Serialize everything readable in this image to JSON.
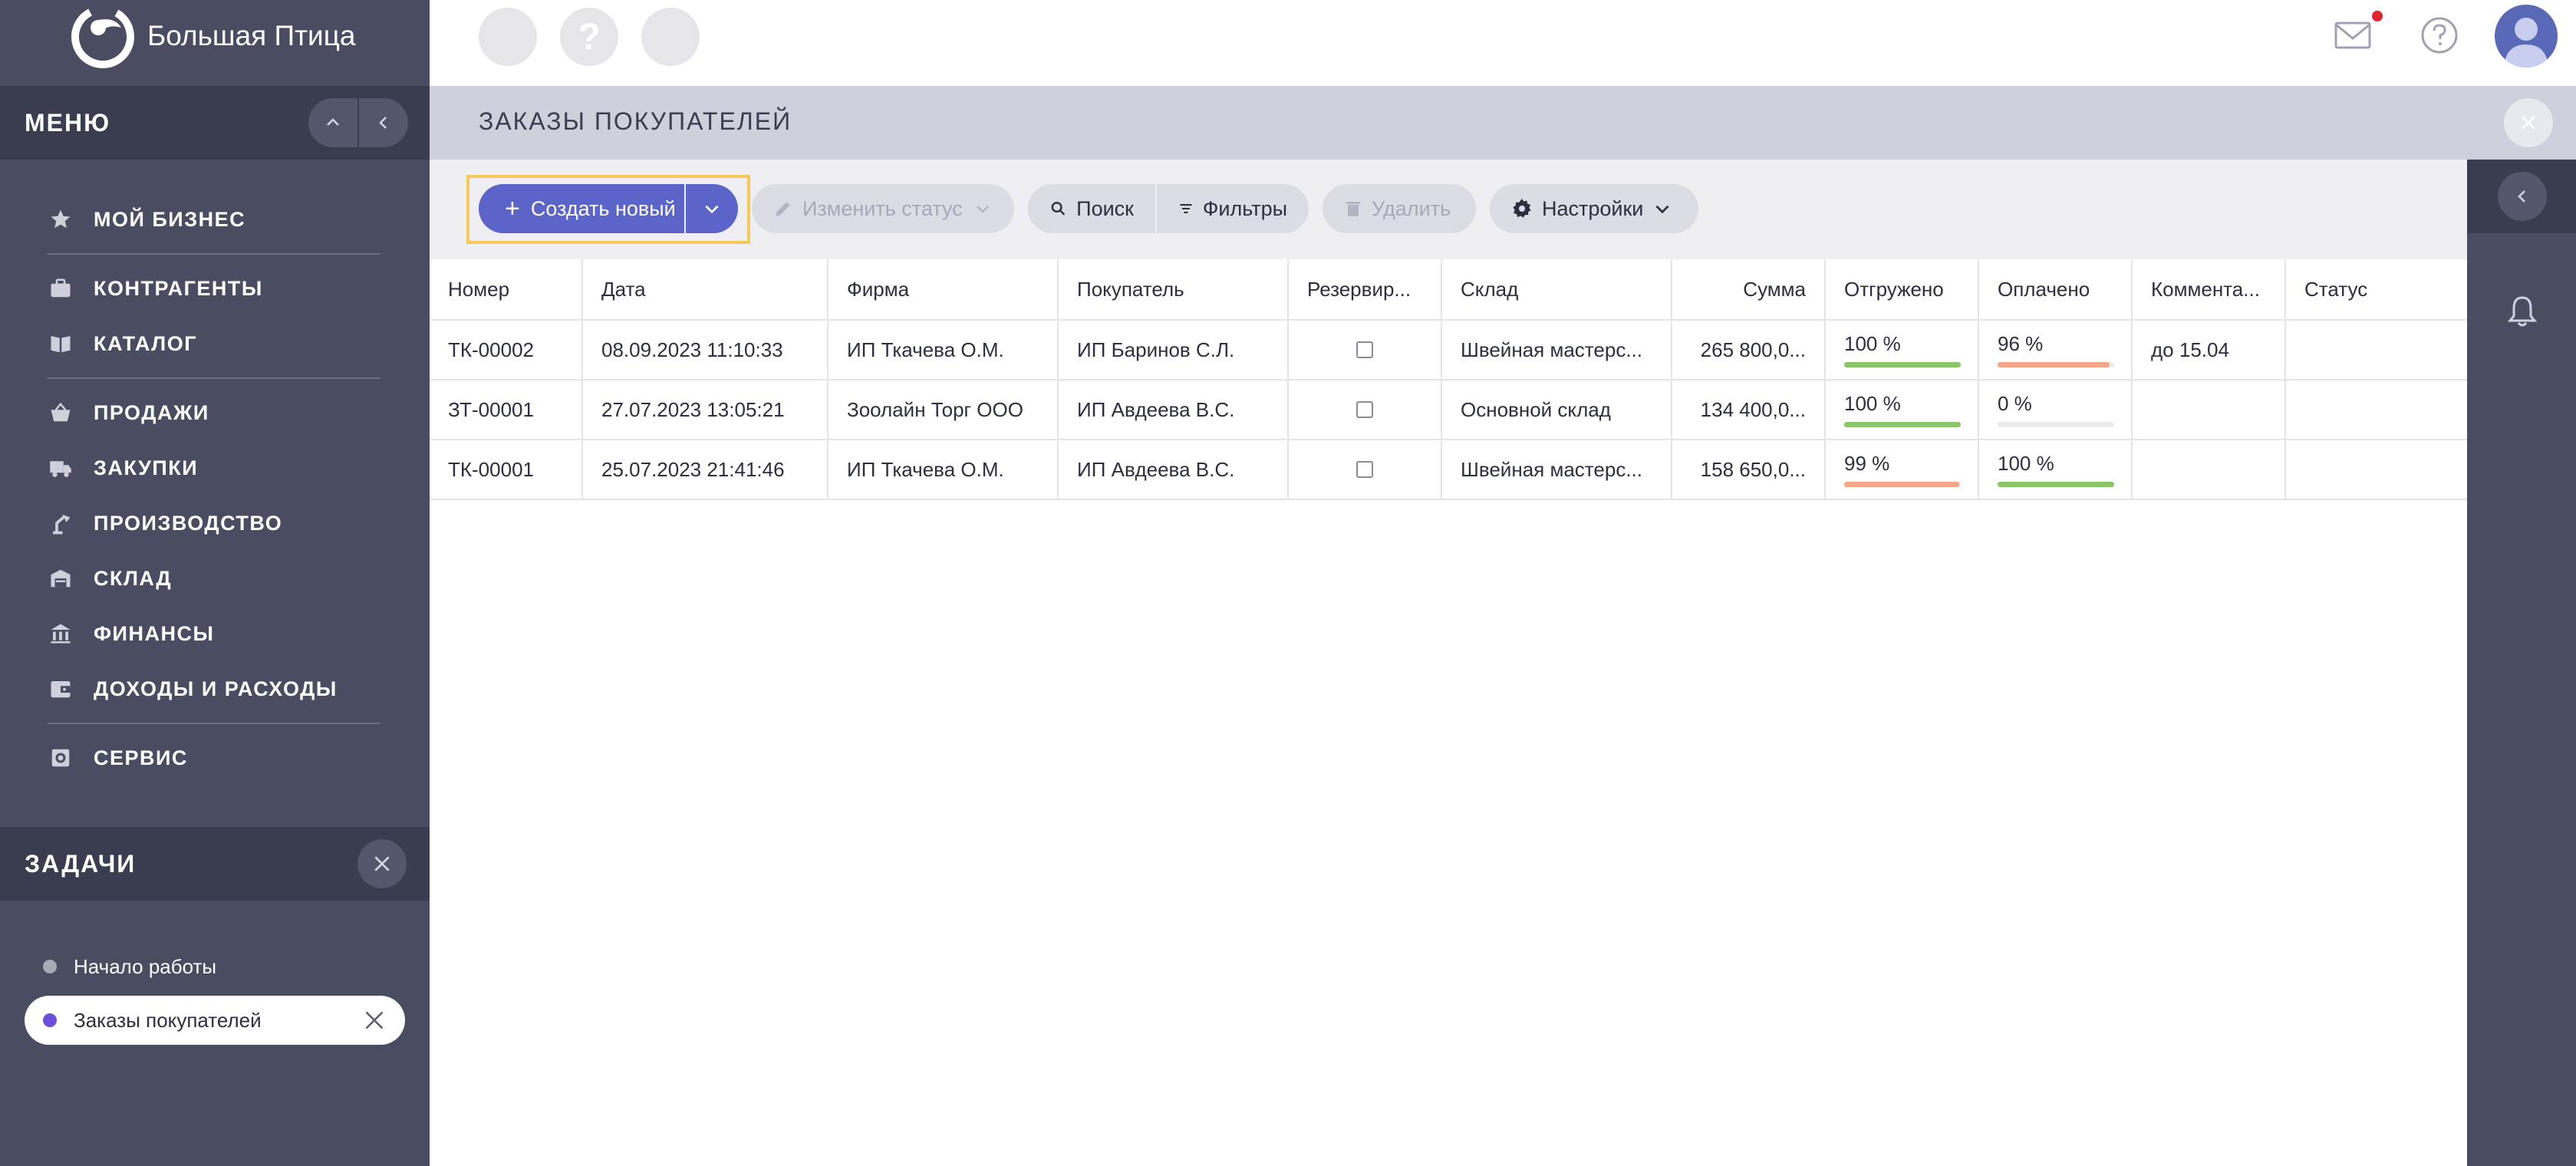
{
  "app": {
    "brand": "Большая Птица"
  },
  "menu": {
    "title": "МЕНЮ",
    "items": [
      {
        "label": "МОЙ БИЗНЕС",
        "icon": "star-icon"
      },
      {
        "label": "КОНТРАГЕНТЫ",
        "icon": "briefcase-icon"
      },
      {
        "label": "КАТАЛОГ",
        "icon": "book-icon"
      },
      {
        "label": "ПРОДАЖИ",
        "icon": "basket-icon"
      },
      {
        "label": "ЗАКУПКИ",
        "icon": "truck-icon"
      },
      {
        "label": "ПРОИЗВОДСТВО",
        "icon": "lamp-icon"
      },
      {
        "label": "СКЛАД",
        "icon": "warehouse-icon"
      },
      {
        "label": "ФИНАНСЫ",
        "icon": "bank-icon"
      },
      {
        "label": "ДОХОДЫ И РАСХОДЫ",
        "icon": "wallet-icon"
      },
      {
        "label": "СЕРВИС",
        "icon": "service-icon"
      }
    ]
  },
  "tasks": {
    "title": "ЗАДАЧИ",
    "items": [
      {
        "label": "Начало работы",
        "dot_color": "#a8a9b4"
      },
      {
        "label": "Заказы покупателей",
        "dot_color": "#6b4fd8"
      }
    ]
  },
  "page": {
    "title": "ЗАКАЗЫ ПОКУПАТЕЛЕЙ"
  },
  "toolbar": {
    "create": "Создать новый",
    "change_status": "Изменить статус",
    "search": "Поиск",
    "filters": "Фильтры",
    "delete": "Удалить",
    "settings": "Настройки"
  },
  "table": {
    "columns": [
      "Номер",
      "Дата",
      "Фирма",
      "Покупатель",
      "Резервир...",
      "Склад",
      "Сумма",
      "Отгружено",
      "Оплачено",
      "Коммента...",
      "Статус"
    ],
    "rows": [
      {
        "number": "ТК-00002",
        "date": "08.09.2023 11:10:33",
        "firm": "ИП Ткачева О.М.",
        "buyer": "ИП Баринов С.Л.",
        "reserved": false,
        "warehouse": "Швейная мастерс...",
        "sum": "265 800,0...",
        "shipped": "100 %",
        "shipped_pct": 100,
        "shipped_color": "#8cc46a",
        "paid": "96 %",
        "paid_pct": 96,
        "paid_color": "#f4a688",
        "comment": "до 15.04",
        "status": ""
      },
      {
        "number": "ЗТ-00001",
        "date": "27.07.2023 13:05:21",
        "firm": "Зоолайн Торг ООО",
        "buyer": "ИП Авдеева В.С.",
        "reserved": false,
        "warehouse": "Основной склад",
        "sum": "134 400,0...",
        "shipped": "100 %",
        "shipped_pct": 100,
        "shipped_color": "#8cc46a",
        "paid": "0 %",
        "paid_pct": 0,
        "paid_color": "#f4a688",
        "comment": "",
        "status": ""
      },
      {
        "number": "ТК-00001",
        "date": "25.07.2023 21:41:46",
        "firm": "ИП Ткачева О.М.",
        "buyer": "ИП Авдеева В.С.",
        "reserved": false,
        "warehouse": "Швейная мастерс...",
        "sum": "158 650,0...",
        "shipped": "99 %",
        "shipped_pct": 99,
        "shipped_color": "#f4a688",
        "paid": "100 %",
        "paid_pct": 100,
        "paid_color": "#8cc46a",
        "comment": "",
        "status": ""
      }
    ]
  },
  "colors": {
    "sidebar": "#4a4c62",
    "sidebar_dark": "#3a3c50",
    "accent": "#5b64c9",
    "highlight": "#f5c85a"
  }
}
